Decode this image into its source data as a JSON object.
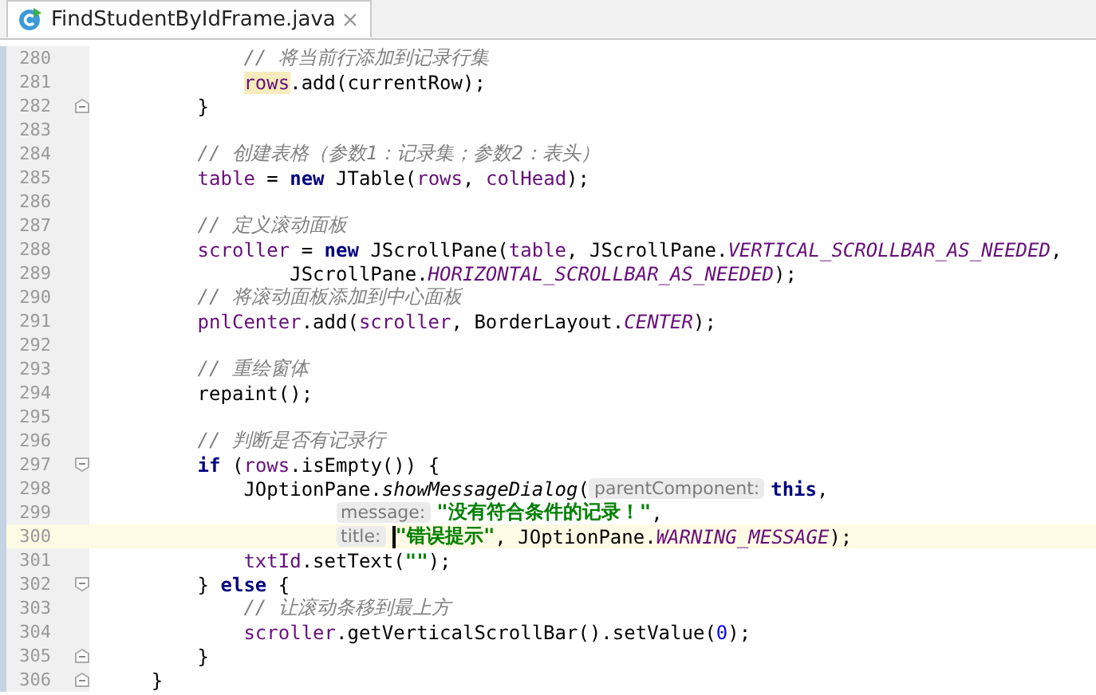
{
  "tabs": [
    {
      "title": "FindStudentByIdFrame.java",
      "selected": true
    }
  ],
  "lines": [
    {
      "number": "280",
      "current": false,
      "tokens": [
        {
          "kind": "comment",
          "text": "            // 将当前行添加到记录行集"
        }
      ]
    },
    {
      "number": "281",
      "current": false,
      "tokens": [
        {
          "kind": "usage",
          "text": "            rows"
        },
        {
          "kind": "text",
          "text": ".add(currentRow);"
        }
      ]
    },
    {
      "number": "282",
      "current": false,
      "fold": {
        "kind": "end"
      },
      "tokens": [
        {
          "kind": "text",
          "text": "        }"
        }
      ]
    },
    {
      "number": "283",
      "current": false
    },
    {
      "number": "284",
      "current": false,
      "tokens": [
        {
          "kind": "comment",
          "text": "        // 创建表格（参数1：记录集；参数2：表头）"
        }
      ]
    },
    {
      "number": "285",
      "current": false,
      "tokens": [
        {
          "kind": "field",
          "text": "        table"
        },
        {
          "kind": "text",
          "text": " = "
        },
        {
          "kind": "kw",
          "text": "new"
        },
        {
          "kind": "text",
          "text": " JTable("
        },
        {
          "kind": "field",
          "text": "rows"
        },
        {
          "kind": "text",
          "text": ", "
        },
        {
          "kind": "field",
          "text": "colHead"
        },
        {
          "kind": "text",
          "text": ");"
        }
      ]
    },
    {
      "number": "286",
      "current": false
    },
    {
      "number": "287",
      "current": false,
      "tokens": [
        {
          "kind": "comment",
          "text": "        // 定义滚动面板"
        }
      ]
    },
    {
      "number": "288",
      "current": false,
      "tokens": [
        {
          "kind": "field",
          "text": "        scroller"
        },
        {
          "kind": "text",
          "text": " = "
        },
        {
          "kind": "kw",
          "text": "new"
        },
        {
          "kind": "text",
          "text": " JScrollPane("
        },
        {
          "kind": "field",
          "text": "table"
        },
        {
          "kind": "text",
          "text": ", JScrollPane."
        },
        {
          "kind": "const",
          "text": "VERTICAL_SCROLLBAR_AS_NEEDED"
        },
        {
          "kind": "text",
          "text": ","
        }
      ]
    },
    {
      "number": "289",
      "current": false,
      "tokens": [
        {
          "kind": "text",
          "text": "                JScrollPane."
        },
        {
          "kind": "const",
          "text": "HORIZONTAL_SCROLLBAR_AS_NEEDED"
        },
        {
          "kind": "text",
          "text": ");"
        }
      ]
    },
    {
      "number": "290",
      "current": false,
      "tokens": [
        {
          "kind": "comment",
          "text": "        // 将滚动面板添加到中心面板"
        }
      ]
    },
    {
      "number": "291",
      "current": false,
      "tokens": [
        {
          "kind": "field",
          "text": "        pnlCenter"
        },
        {
          "kind": "text",
          "text": ".add("
        },
        {
          "kind": "field",
          "text": "scroller"
        },
        {
          "kind": "text",
          "text": ", BorderLayout."
        },
        {
          "kind": "const",
          "text": "CENTER"
        },
        {
          "kind": "text",
          "text": ");"
        }
      ]
    },
    {
      "number": "292",
      "current": false
    },
    {
      "number": "293",
      "current": false,
      "tokens": [
        {
          "kind": "comment",
          "text": "        // 重绘窗体"
        }
      ]
    },
    {
      "number": "294",
      "current": false,
      "tokens": [
        {
          "kind": "text",
          "text": "        repaint();"
        }
      ]
    },
    {
      "number": "295",
      "current": false
    },
    {
      "number": "296",
      "current": false,
      "tokens": [
        {
          "kind": "comment",
          "text": "        // 判断是否有记录行"
        }
      ]
    },
    {
      "number": "297",
      "current": false,
      "fold": {
        "kind": "start"
      },
      "tokens": [
        {
          "kind": "kw",
          "text": "        if"
        },
        {
          "kind": "text",
          "text": " ("
        },
        {
          "kind": "field",
          "text": "rows"
        },
        {
          "kind": "text",
          "text": ".isEmpty()) {"
        }
      ]
    },
    {
      "number": "298",
      "current": false,
      "tokens": [
        {
          "kind": "text",
          "text": "            JOptionPane."
        },
        {
          "kind": "static_call",
          "text": "showMessageDialog"
        },
        {
          "kind": "text",
          "text": "("
        },
        {
          "kind": "hint",
          "text": "parentComponent:"
        },
        {
          "kind": "kw",
          "text": "this"
        },
        {
          "kind": "text",
          "text": ","
        }
      ]
    },
    {
      "number": "299",
      "current": false,
      "tokens": [
        {
          "kind": "hint",
          "text": "                    message:"
        },
        {
          "kind": "str",
          "text": "\"没有符合条件的记录！\""
        },
        {
          "kind": "text",
          "text": ","
        }
      ]
    },
    {
      "number": "300",
      "current": true,
      "tokens": [
        {
          "kind": "hint",
          "text": "                    title:"
        },
        {
          "kind": "caret"
        },
        {
          "kind": "str",
          "text": "\"错误提示\""
        },
        {
          "kind": "text",
          "text": ", JOptionPane."
        },
        {
          "kind": "const",
          "text": "WARNING_MESSAGE"
        },
        {
          "kind": "text",
          "text": ");"
        }
      ]
    },
    {
      "number": "301",
      "current": false,
      "tokens": [
        {
          "kind": "field",
          "text": "            txtId"
        },
        {
          "kind": "text",
          "text": ".setText("
        },
        {
          "kind": "str",
          "text": "\"\""
        },
        {
          "kind": "text",
          "text": ");"
        }
      ]
    },
    {
      "number": "302",
      "current": false,
      "fold": {
        "kind": "start"
      },
      "tokens": [
        {
          "kind": "text",
          "text": "        } "
        },
        {
          "kind": "kw",
          "text": "else"
        },
        {
          "kind": "text",
          "text": " {"
        }
      ]
    },
    {
      "number": "303",
      "current": false,
      "tokens": [
        {
          "kind": "comment",
          "text": "            // 让滚动条移到最上方"
        }
      ]
    },
    {
      "number": "304",
      "current": false,
      "tokens": [
        {
          "kind": "field",
          "text": "            scroller"
        },
        {
          "kind": "text",
          "text": ".getVerticalScrollBar().setValue("
        },
        {
          "kind": "num",
          "text": "0"
        },
        {
          "kind": "text",
          "text": ");"
        }
      ]
    },
    {
      "number": "305",
      "current": false,
      "fold": {
        "kind": "end"
      },
      "tokens": [
        {
          "kind": "text",
          "text": "        }"
        }
      ]
    },
    {
      "number": "306",
      "current": false,
      "fold": {
        "kind": "end"
      },
      "tokens": [
        {
          "kind": "text",
          "text": "    }"
        }
      ]
    }
  ]
}
